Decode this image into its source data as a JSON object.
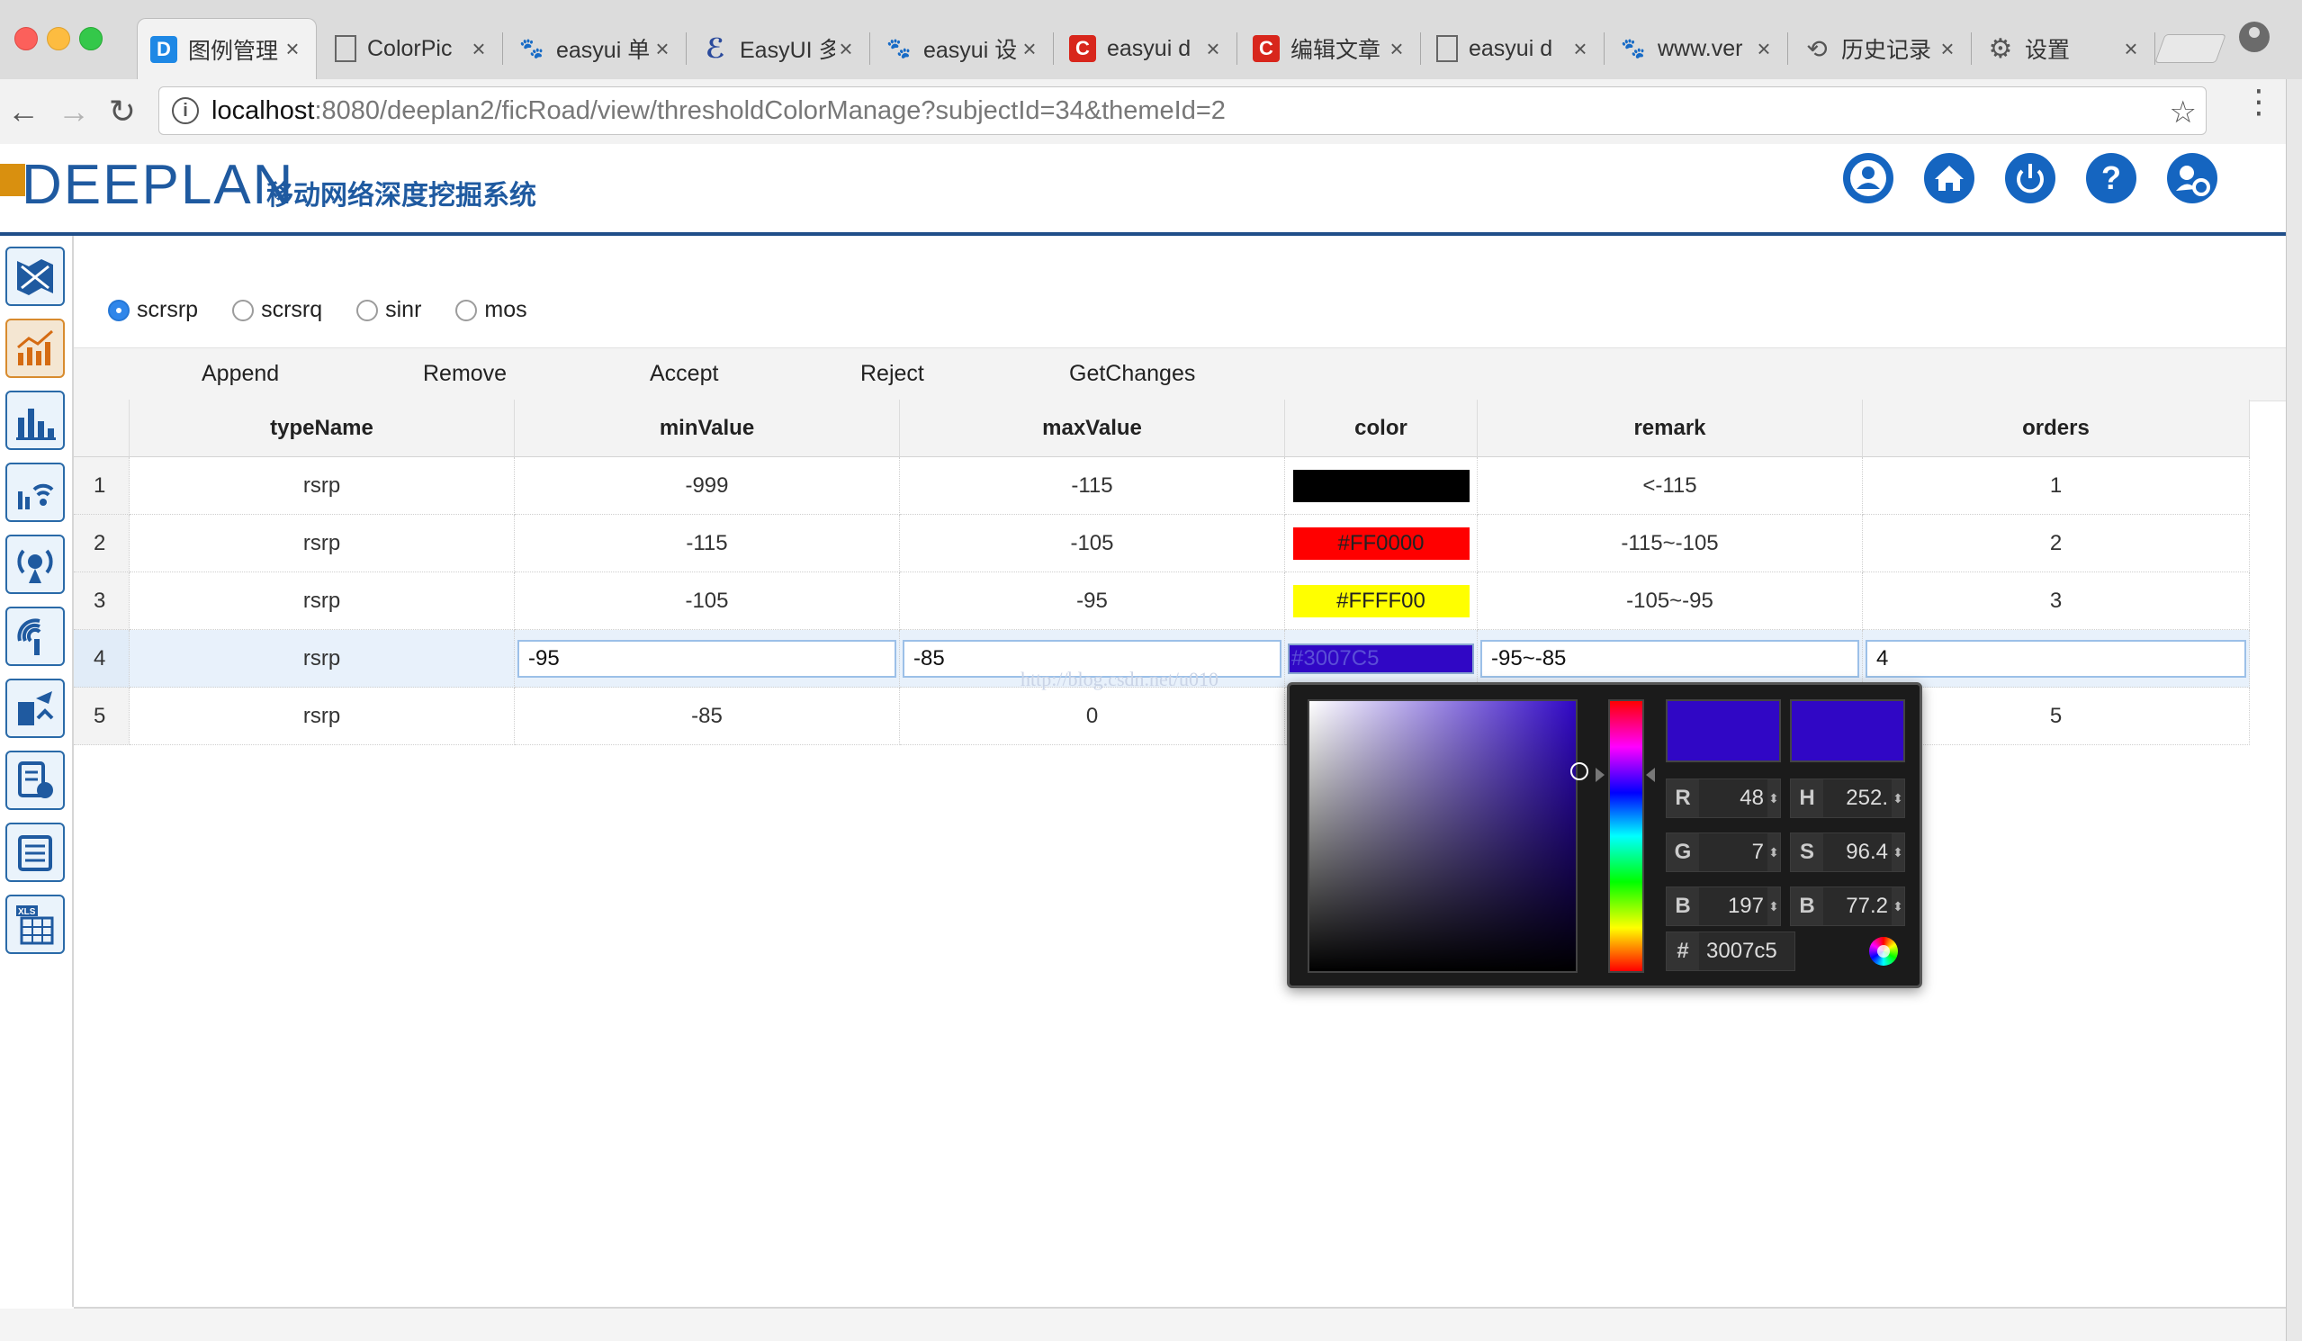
{
  "browser": {
    "tabs": [
      {
        "title": "图例管理",
        "icon": "deeplan-icon",
        "active": true
      },
      {
        "title": "ColorPic",
        "icon": "page-icon"
      },
      {
        "title": "easyui 单",
        "icon": "paw-icon"
      },
      {
        "title": "EasyUI 多",
        "icon": "easyui-icon"
      },
      {
        "title": "easyui 设",
        "icon": "paw-icon"
      },
      {
        "title": "easyui d",
        "icon": "csdn-icon"
      },
      {
        "title": "编辑文章",
        "icon": "csdn-icon"
      },
      {
        "title": "easyui d",
        "icon": "page-icon"
      },
      {
        "title": "www.ver",
        "icon": "paw-icon"
      },
      {
        "title": "历史记录",
        "icon": "history-icon"
      },
      {
        "title": "设置",
        "icon": "gear-icon"
      }
    ],
    "address": {
      "host": "localhost",
      "path": ":8080/deeplan2/ficRoad/view/thresholdColorManage?subjectId=34&themeId=2"
    }
  },
  "header": {
    "logo_text": "DEEPLAN",
    "subtitle": "移动网络深度挖掘系统",
    "icons": [
      "user-icon",
      "home-icon",
      "power-icon",
      "help-icon",
      "settings-icon"
    ]
  },
  "sidebar": {
    "items": [
      "map-icon",
      "line-chart-icon",
      "bar-chart-icon",
      "signal-icon",
      "antenna-icon",
      "broadcast-icon",
      "report-icon",
      "document-edit-icon",
      "list-icon",
      "xls-icon"
    ]
  },
  "radios": {
    "options": [
      {
        "label": "scrsrp",
        "checked": true
      },
      {
        "label": "scrsrq",
        "checked": false
      },
      {
        "label": "sinr",
        "checked": false
      },
      {
        "label": "mos",
        "checked": false
      }
    ]
  },
  "toolbar": {
    "append": "Append",
    "remove": "Remove",
    "accept": "Accept",
    "reject": "Reject",
    "get_changes": "GetChanges"
  },
  "grid": {
    "columns": [
      "typeName",
      "minValue",
      "maxValue",
      "color",
      "remark",
      "orders"
    ],
    "rows": [
      {
        "num": "1",
        "typeName": "rsrp",
        "minValue": "-999",
        "maxValue": "-115",
        "color": "#000000",
        "color_label": "",
        "remark": "<-115",
        "orders": "1"
      },
      {
        "num": "2",
        "typeName": "rsrp",
        "minValue": "-115",
        "maxValue": "-105",
        "color": "#FF0000",
        "color_label": "#FF0000",
        "remark": "-115~-105",
        "orders": "2"
      },
      {
        "num": "3",
        "typeName": "rsrp",
        "minValue": "-105",
        "maxValue": "-95",
        "color": "#FFFF00",
        "color_label": "#FFFF00",
        "remark": "-105~-95",
        "orders": "3"
      },
      {
        "num": "4",
        "typeName": "rsrp",
        "minValue": "-95",
        "maxValue": "-85",
        "color": "#3007C5",
        "color_label": "#3007C5",
        "remark": "-95~-85",
        "orders": "4"
      },
      {
        "num": "5",
        "typeName": "rsrp",
        "minValue": "-85",
        "maxValue": "0",
        "color": "",
        "color_label": "",
        "remark": "",
        "orders": "5"
      }
    ]
  },
  "picker": {
    "r_label": "R",
    "r": "48",
    "g_label": "G",
    "g": "7",
    "b_label": "B",
    "b": "197",
    "h_label": "H",
    "h": "252.",
    "s_label": "S",
    "s": "96.4",
    "br_label": "B",
    "br": "77.2",
    "hex_label": "#",
    "hex": "3007c5",
    "current_color": "#3007c5"
  },
  "watermark": "http://blog.csdn.net/u010"
}
